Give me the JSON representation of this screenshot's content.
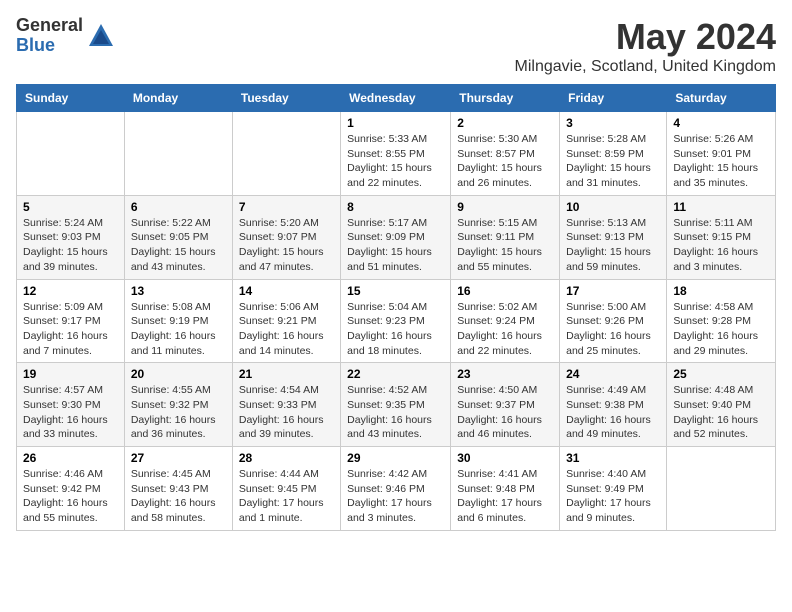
{
  "logo": {
    "general": "General",
    "blue": "Blue"
  },
  "title": "May 2024",
  "location": "Milngavie, Scotland, United Kingdom",
  "days_of_week": [
    "Sunday",
    "Monday",
    "Tuesday",
    "Wednesday",
    "Thursday",
    "Friday",
    "Saturday"
  ],
  "weeks": [
    [
      {
        "day": "",
        "info": ""
      },
      {
        "day": "",
        "info": ""
      },
      {
        "day": "",
        "info": ""
      },
      {
        "day": "1",
        "info": "Sunrise: 5:33 AM\nSunset: 8:55 PM\nDaylight: 15 hours and 22 minutes."
      },
      {
        "day": "2",
        "info": "Sunrise: 5:30 AM\nSunset: 8:57 PM\nDaylight: 15 hours and 26 minutes."
      },
      {
        "day": "3",
        "info": "Sunrise: 5:28 AM\nSunset: 8:59 PM\nDaylight: 15 hours and 31 minutes."
      },
      {
        "day": "4",
        "info": "Sunrise: 5:26 AM\nSunset: 9:01 PM\nDaylight: 15 hours and 35 minutes."
      }
    ],
    [
      {
        "day": "5",
        "info": "Sunrise: 5:24 AM\nSunset: 9:03 PM\nDaylight: 15 hours and 39 minutes."
      },
      {
        "day": "6",
        "info": "Sunrise: 5:22 AM\nSunset: 9:05 PM\nDaylight: 15 hours and 43 minutes."
      },
      {
        "day": "7",
        "info": "Sunrise: 5:20 AM\nSunset: 9:07 PM\nDaylight: 15 hours and 47 minutes."
      },
      {
        "day": "8",
        "info": "Sunrise: 5:17 AM\nSunset: 9:09 PM\nDaylight: 15 hours and 51 minutes."
      },
      {
        "day": "9",
        "info": "Sunrise: 5:15 AM\nSunset: 9:11 PM\nDaylight: 15 hours and 55 minutes."
      },
      {
        "day": "10",
        "info": "Sunrise: 5:13 AM\nSunset: 9:13 PM\nDaylight: 15 hours and 59 minutes."
      },
      {
        "day": "11",
        "info": "Sunrise: 5:11 AM\nSunset: 9:15 PM\nDaylight: 16 hours and 3 minutes."
      }
    ],
    [
      {
        "day": "12",
        "info": "Sunrise: 5:09 AM\nSunset: 9:17 PM\nDaylight: 16 hours and 7 minutes."
      },
      {
        "day": "13",
        "info": "Sunrise: 5:08 AM\nSunset: 9:19 PM\nDaylight: 16 hours and 11 minutes."
      },
      {
        "day": "14",
        "info": "Sunrise: 5:06 AM\nSunset: 9:21 PM\nDaylight: 16 hours and 14 minutes."
      },
      {
        "day": "15",
        "info": "Sunrise: 5:04 AM\nSunset: 9:23 PM\nDaylight: 16 hours and 18 minutes."
      },
      {
        "day": "16",
        "info": "Sunrise: 5:02 AM\nSunset: 9:24 PM\nDaylight: 16 hours and 22 minutes."
      },
      {
        "day": "17",
        "info": "Sunrise: 5:00 AM\nSunset: 9:26 PM\nDaylight: 16 hours and 25 minutes."
      },
      {
        "day": "18",
        "info": "Sunrise: 4:58 AM\nSunset: 9:28 PM\nDaylight: 16 hours and 29 minutes."
      }
    ],
    [
      {
        "day": "19",
        "info": "Sunrise: 4:57 AM\nSunset: 9:30 PM\nDaylight: 16 hours and 33 minutes."
      },
      {
        "day": "20",
        "info": "Sunrise: 4:55 AM\nSunset: 9:32 PM\nDaylight: 16 hours and 36 minutes."
      },
      {
        "day": "21",
        "info": "Sunrise: 4:54 AM\nSunset: 9:33 PM\nDaylight: 16 hours and 39 minutes."
      },
      {
        "day": "22",
        "info": "Sunrise: 4:52 AM\nSunset: 9:35 PM\nDaylight: 16 hours and 43 minutes."
      },
      {
        "day": "23",
        "info": "Sunrise: 4:50 AM\nSunset: 9:37 PM\nDaylight: 16 hours and 46 minutes."
      },
      {
        "day": "24",
        "info": "Sunrise: 4:49 AM\nSunset: 9:38 PM\nDaylight: 16 hours and 49 minutes."
      },
      {
        "day": "25",
        "info": "Sunrise: 4:48 AM\nSunset: 9:40 PM\nDaylight: 16 hours and 52 minutes."
      }
    ],
    [
      {
        "day": "26",
        "info": "Sunrise: 4:46 AM\nSunset: 9:42 PM\nDaylight: 16 hours and 55 minutes."
      },
      {
        "day": "27",
        "info": "Sunrise: 4:45 AM\nSunset: 9:43 PM\nDaylight: 16 hours and 58 minutes."
      },
      {
        "day": "28",
        "info": "Sunrise: 4:44 AM\nSunset: 9:45 PM\nDaylight: 17 hours and 1 minute."
      },
      {
        "day": "29",
        "info": "Sunrise: 4:42 AM\nSunset: 9:46 PM\nDaylight: 17 hours and 3 minutes."
      },
      {
        "day": "30",
        "info": "Sunrise: 4:41 AM\nSunset: 9:48 PM\nDaylight: 17 hours and 6 minutes."
      },
      {
        "day": "31",
        "info": "Sunrise: 4:40 AM\nSunset: 9:49 PM\nDaylight: 17 hours and 9 minutes."
      },
      {
        "day": "",
        "info": ""
      }
    ]
  ]
}
